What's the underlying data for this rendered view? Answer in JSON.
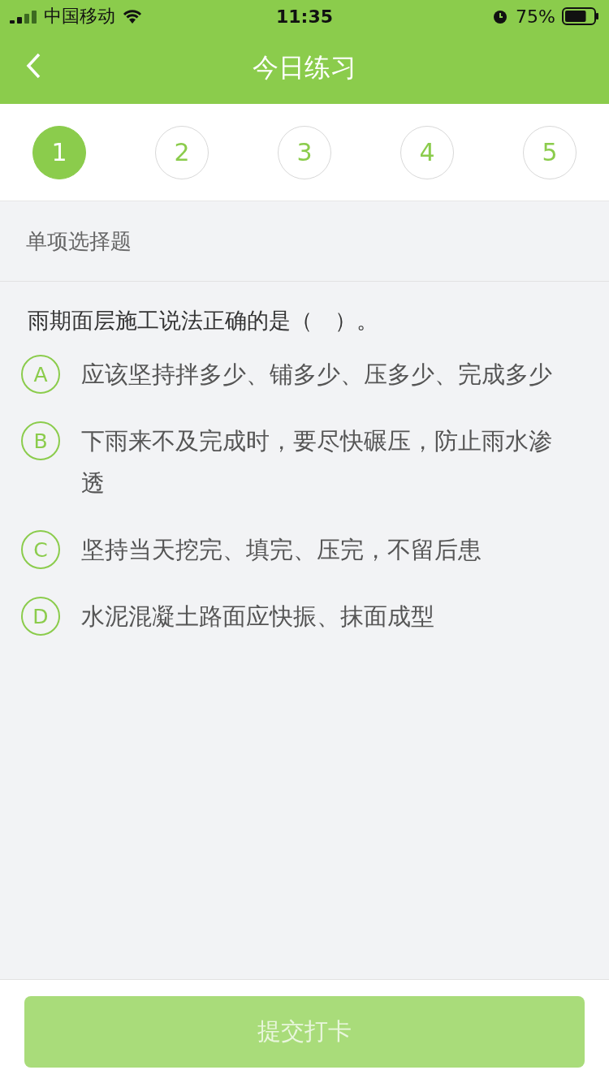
{
  "status_bar": {
    "carrier": "中国移动",
    "time": "11:35",
    "battery": "75%"
  },
  "header": {
    "title": "今日练习"
  },
  "steps": [
    {
      "label": "1",
      "selected": true
    },
    {
      "label": "2",
      "selected": false
    },
    {
      "label": "3",
      "selected": false
    },
    {
      "label": "4",
      "selected": false
    },
    {
      "label": "5",
      "selected": false
    }
  ],
  "question_type": "单项选择题",
  "question": "雨期面层施工说法正确的是（　）。",
  "options": [
    {
      "letter": "A",
      "text": "应该坚持拌多少、铺多少、压多少、完成多少",
      "selected": false
    },
    {
      "letter": "B",
      "text": "下雨来不及完成时，要尽快碾压，防止雨水渗透",
      "selected": false
    },
    {
      "letter": "C",
      "text": "坚持当天挖完、填完、压完，不留后患",
      "selected": false
    },
    {
      "letter": "D",
      "text": "水泥混凝土路面应快振、抹面成型",
      "selected": false
    }
  ],
  "submit": {
    "label": "提交打卡",
    "disabled": true
  }
}
